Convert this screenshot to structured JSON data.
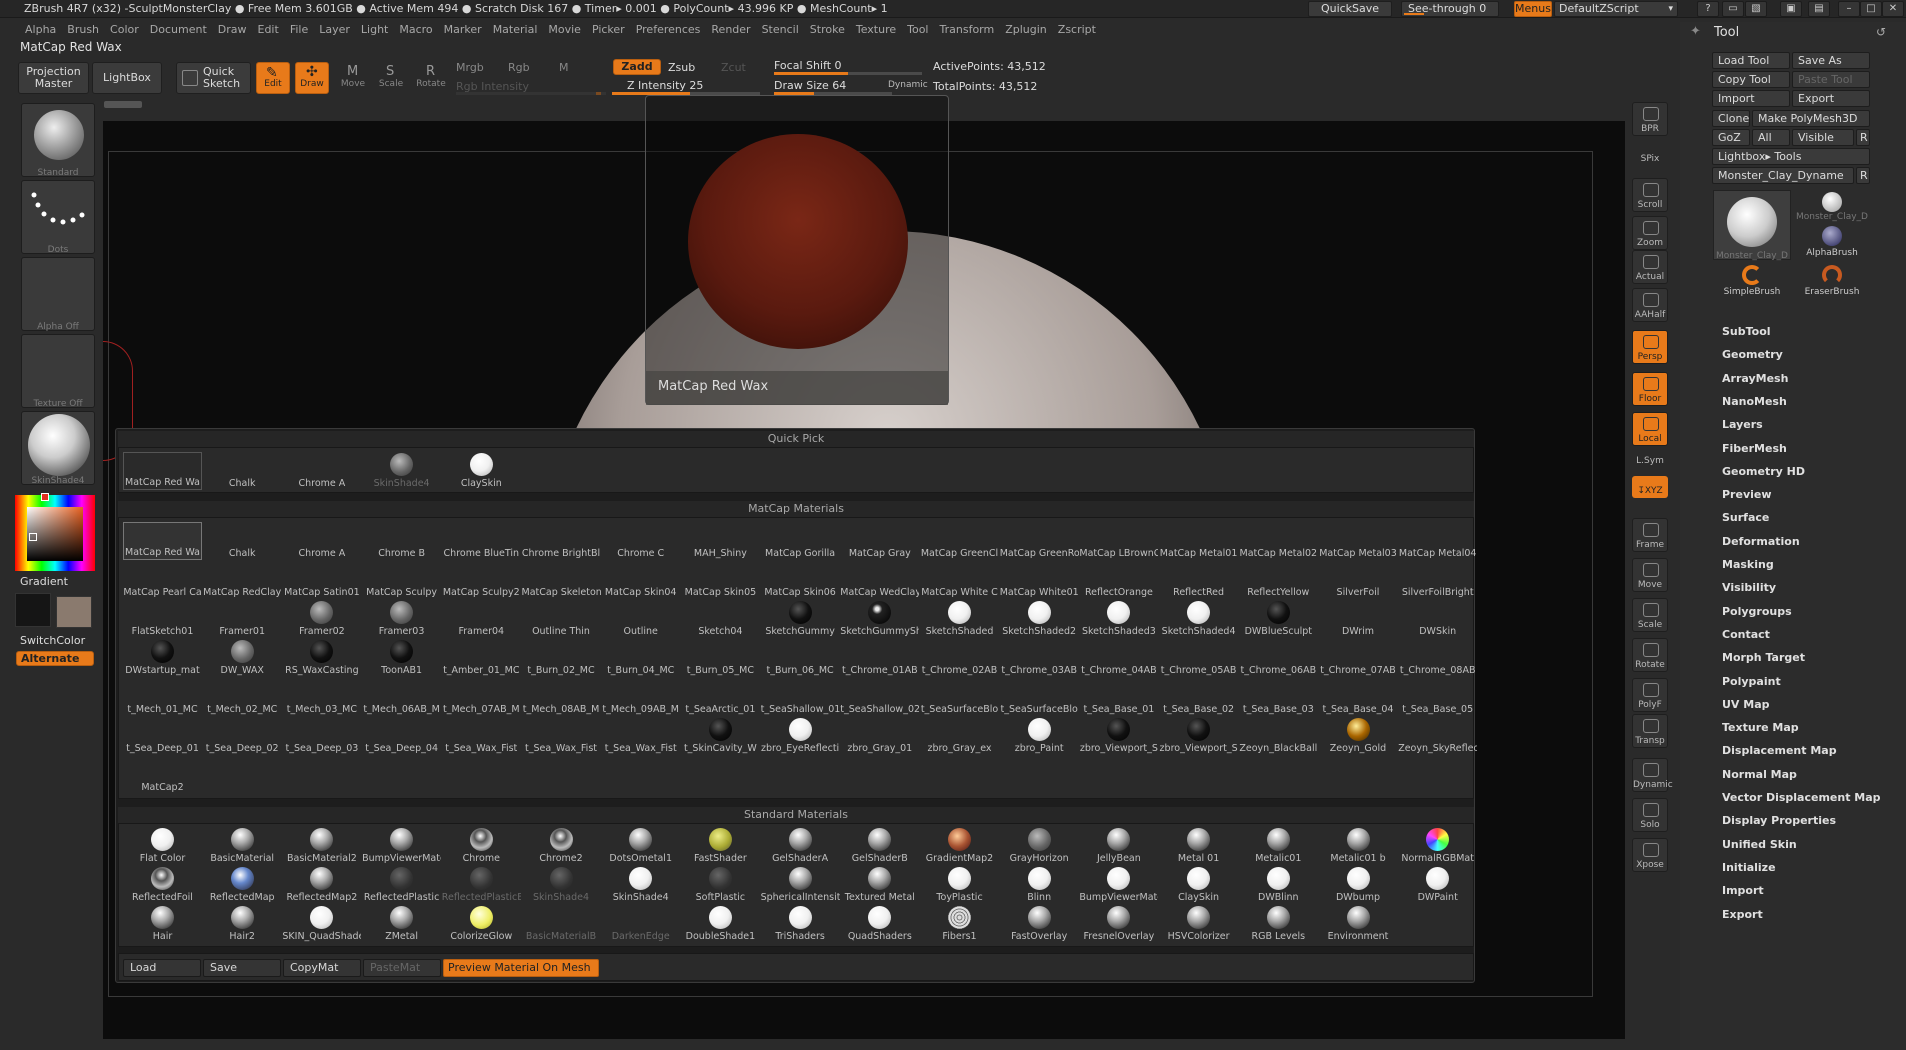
{
  "title_bar": {
    "text": "ZBrush 4R7 (x32)   -SculptMonsterClay   ● Free Mem 3.601GB ● Active Mem 494 ● Scratch Disk 167 ●  Timer▸ 0.001 ● PolyCount▸ 43.996 KP  ● MeshCount▸ 1",
    "quicksave": "QuickSave",
    "see_through": "See-through  0",
    "menus": "Menus",
    "script": "DefaultZScript"
  },
  "menu_bar": [
    "Alpha",
    "Brush",
    "Color",
    "Document",
    "Draw",
    "Edit",
    "File",
    "Layer",
    "Light",
    "Macro",
    "Marker",
    "Material",
    "Movie",
    "Picker",
    "Preferences",
    "Render",
    "Stencil",
    "Stroke",
    "Texture",
    "Tool",
    "Transform",
    "Zplugin",
    "Zscript"
  ],
  "material_name": "MatCap Red Wax",
  "top_shelf": {
    "projection_master": "Projection Master",
    "lightbox": "LightBox",
    "quick_sketch": "Quick Sketch",
    "edit": "Edit",
    "draw": "Draw",
    "move": "Move",
    "scale": "Scale",
    "rotate": "Rotate",
    "mrgb": "Mrgb",
    "rgb": "Rgb",
    "m": "M",
    "zadd": "Zadd",
    "zsub": "Zsub",
    "zcut": "Zcut",
    "rgb_intensity": "Rgb Intensity",
    "z_intensity": "Z Intensity 25",
    "focal_shift": "Focal Shift 0",
    "draw_size": "Draw Size 64",
    "dynamic": "Dynamic",
    "active_points": "ActivePoints: 43,512",
    "total_points": "TotalPoints: 43,512"
  },
  "left_panel": {
    "standard": "Standard",
    "dots": "Dots",
    "alpha_off": "Alpha Off",
    "texture_off": "Texture Off",
    "skinshade": "SkinShade4",
    "gradient": "Gradient",
    "switchcolor": "SwitchColor",
    "alternate": "Alternate"
  },
  "preview_popup_label": "MatCap Red Wax",
  "right_strip": [
    {
      "name": "bpr",
      "label": "BPR"
    },
    {
      "name": "spix",
      "label": "SPix"
    },
    {
      "name": "scroll",
      "label": "Scroll"
    },
    {
      "name": "zoom",
      "label": "Zoom"
    },
    {
      "name": "actual",
      "label": "Actual"
    },
    {
      "name": "aahalf",
      "label": "AAHalf"
    },
    {
      "name": "persp",
      "label": "Persp"
    },
    {
      "name": "floor",
      "label": "Floor"
    },
    {
      "name": "local",
      "label": "Local"
    },
    {
      "name": "lsym",
      "label": "L.Sym"
    },
    {
      "name": "xyz",
      "label": "↧XYZ"
    },
    {
      "name": "frame",
      "label": "Frame"
    },
    {
      "name": "move",
      "label": "Move"
    },
    {
      "name": "scale",
      "label": "Scale"
    },
    {
      "name": "rotate",
      "label": "Rotate"
    },
    {
      "name": "polyf",
      "label": "PolyF"
    },
    {
      "name": "transp",
      "label": "Transp"
    },
    {
      "name": "ghost",
      "label": "Dynamic"
    },
    {
      "name": "solo",
      "label": "Solo"
    },
    {
      "name": "xpose",
      "label": "Xpose"
    }
  ],
  "tool_panel": {
    "title": "Tool",
    "load_tool": "Load Tool",
    "save_as": "Save As",
    "copy_tool": "Copy Tool",
    "paste_tool": "Paste Tool",
    "import": "Import",
    "export": "Export",
    "clone": "Clone",
    "make_polymesh": "Make PolyMesh3D",
    "goz": "GoZ",
    "all": "All",
    "visible": "Visible",
    "r": "R",
    "lightbox_tools": "Lightbox▸ Tools",
    "current_tool": "Monster_Clay_Dyname",
    "thumbs": [
      "Monster_Clay_D",
      "Monster_Clay_D",
      "AlphaBrush",
      "SimpleBrush",
      "EraserBrush"
    ],
    "menu_items": [
      "SubTool",
      "Geometry",
      "ArrayMesh",
      "NanoMesh",
      "Layers",
      "FiberMesh",
      "Geometry HD",
      "Preview",
      "Surface",
      "Deformation",
      "Masking",
      "Visibility",
      "Polygroups",
      "Contact",
      "Morph Target",
      "Polypaint",
      "UV Map",
      "Texture Map",
      "Displacement Map",
      "Normal Map",
      "Vector Displacement Map",
      "Display Properties",
      "Unified Skin",
      "Initialize",
      "Import",
      "Export"
    ]
  },
  "material_palette": {
    "quick_pick_title": "Quick Pick",
    "quick_pick": [
      {
        "name": "MatCap Red Wa",
        "sphere": "none"
      },
      {
        "name": "Chalk",
        "sphere": "none"
      },
      {
        "name": "Chrome A",
        "sphere": "none"
      },
      {
        "name": "SkinShade4",
        "sphere": "grey",
        "dim": true
      },
      {
        "name": "ClaySkin",
        "sphere": "white"
      }
    ],
    "matcap_title": "MatCap Materials",
    "matcap": [
      [
        "MatCap Red Wa",
        "Chalk",
        "Chrome A",
        "Chrome B",
        "Chrome BlueTin",
        "Chrome BrightBl",
        "Chrome C",
        "MAH_Shiny",
        "MatCap Gorilla",
        "MatCap Gray",
        "MatCap GreenCl",
        "MatCap GreenRo",
        "MatCap LBrownC",
        "MatCap Metal01",
        "MatCap Metal02",
        "MatCap Metal03",
        "MatCap Metal04"
      ],
      [
        "MatCap Pearl Ca",
        "MatCap RedClay",
        "MatCap Satin01",
        "MatCap Sculpy",
        "MatCap Sculpy2",
        "MatCap Skeleton",
        "MatCap Skin04",
        "MatCap Skin05",
        "MatCap Skin06",
        "MatCap WedClay",
        "MatCap White C",
        "MatCap White01",
        "ReflectOrange",
        "ReflectRed",
        "ReflectYellow",
        "SilverFoil",
        "SilverFoilBright"
      ],
      [
        "FlatSketch01",
        "Framer01",
        "Framer02",
        "Framer03",
        "Framer04",
        "Outline Thin",
        "Outline",
        "Sketch04",
        "SketchGummy",
        "SketchGummyShi",
        "SketchShaded",
        "SketchShaded2",
        "SketchShaded3",
        "SketchShaded4",
        "DWBlueSculpt",
        "DWrim",
        "DWSkin"
      ],
      [
        "DWstartup_mat",
        "DW_WAX",
        "RS_WaxCasting",
        "ToonAB1",
        "t_Amber_01_MC",
        "t_Burn_02_MC",
        "t_Burn_04_MC",
        "t_Burn_05_MC",
        "t_Burn_06_MC",
        "t_Chrome_01AB",
        "t_Chrome_02AB",
        "t_Chrome_03AB",
        "t_Chrome_04AB",
        "t_Chrome_05AB",
        "t_Chrome_06AB",
        "t_Chrome_07AB",
        "t_Chrome_08AB"
      ],
      [
        "t_Mech_01_MC",
        "t_Mech_02_MC",
        "t_Mech_03_MC",
        "t_Mech_06AB_M",
        "t_Mech_07AB_M",
        "t_Mech_08AB_M",
        "t_Mech_09AB_M",
        "t_SeaArctic_01",
        "t_SeaShallow_01",
        "t_SeaShallow_02",
        "t_SeaSurfaceBlo",
        "t_SeaSurfaceBlo",
        "t_Sea_Base_01",
        "t_Sea_Base_02",
        "t_Sea_Base_03",
        "t_Sea_Base_04",
        "t_Sea_Base_05"
      ],
      [
        "t_Sea_Deep_01",
        "t_Sea_Deep_02",
        "t_Sea_Deep_03",
        "t_Sea_Deep_04",
        "t_Sea_Wax_Fist",
        "t_Sea_Wax_Fist",
        "t_Sea_Wax_Fist",
        "t_SkinCavity_W",
        "zbro_EyeReflecti",
        "zbro_Gray_01",
        "zbro_Gray_ex",
        "zbro_Paint",
        "zbro_Viewport_S",
        "zbro_Viewport_S",
        "Zeoyn_BlackBall",
        "Zeoyn_Gold",
        "Zeoyn_SkyReflec"
      ],
      [
        "MatCap2"
      ]
    ],
    "matcap_spheres": [
      [
        "",
        "",
        "",
        "",
        "",
        "",
        "",
        "",
        "",
        "",
        "",
        "",
        "",
        "",
        "",
        "",
        ""
      ],
      [
        "",
        "",
        "",
        "",
        "",
        "",
        "",
        "",
        "",
        "",
        "",
        "",
        "",
        "",
        "",
        "",
        ""
      ],
      [
        "",
        "",
        "grey",
        "grey",
        "",
        "",
        "",
        "",
        "black",
        "blackhl",
        "white",
        "white",
        "white",
        "white",
        "black",
        "",
        ""
      ],
      [
        "black",
        "grey",
        "black",
        "black",
        "",
        "",
        "",
        "",
        "",
        "",
        "",
        "",
        "",
        "",
        "",
        "",
        ""
      ],
      [
        "",
        "",
        "",
        "",
        "",
        "",
        "",
        "",
        "",
        "",
        "",
        "",
        "",
        "",
        "",
        "",
        ""
      ],
      [
        "",
        "",
        "",
        "",
        "",
        "",
        "",
        "black",
        "white",
        "",
        "",
        "white",
        "black",
        "black",
        "",
        "gold",
        ""
      ],
      [
        ""
      ]
    ],
    "standard_title": "Standard Materials",
    "standard": [
      [
        "Flat Color",
        "BasicMaterial",
        "BasicMaterial2",
        "BumpViewerMate",
        "Chrome",
        "Chrome2",
        "DotsOmetal1",
        "FastShader",
        "GelShaderA",
        "GelShaderB",
        "GradientMap2",
        "GrayHorizon",
        "JellyBean",
        "Metal 01",
        "Metalic01",
        "Metalic01 b",
        "NormalRGBMat"
      ],
      [
        "ReflectedFoil",
        "ReflectedMap",
        "ReflectedMap2",
        "ReflectedPlastic",
        "ReflectedPlasticB",
        "SkinShade4",
        "SkinShade4",
        "SoftPlastic",
        "SphericalIntensity",
        "Textured Metal",
        "ToyPlastic",
        "Blinn",
        "BumpViewerMate",
        "ClaySkin",
        "DWBlinn",
        "DWbump",
        "DWPaint"
      ],
      [
        "Hair",
        "Hair2",
        "SKIN_QuadShader",
        "ZMetal",
        "ColorizeGlow",
        "BasicMaterialB",
        "DarkenEdge",
        "DoubleShade1",
        "TriShaders",
        "QuadShaders",
        "Fibers1",
        "FastOverlay",
        "FresnelOverlay",
        "HSVColorizer",
        "RGB Levels",
        "Environment",
        ""
      ]
    ],
    "standard_spheres": [
      [
        "white",
        "silver",
        "silver",
        "silver",
        "chrome",
        "chrome",
        "silver",
        "yellow",
        "silver",
        "silver",
        "copper",
        "grey",
        "silver",
        "silver",
        "silver",
        "silver",
        "rainbow"
      ],
      [
        "chrome",
        "blue",
        "silver",
        "dark",
        "dark",
        "dark",
        "white",
        "dark",
        "silver",
        "silver",
        "white",
        "white",
        "white",
        "white",
        "white",
        "white",
        "white"
      ],
      [
        "silver",
        "silver",
        "white",
        "silver",
        "yellowglow",
        "",
        "",
        "white",
        "white",
        "white",
        "fibers",
        "silver",
        "silver",
        "silver",
        "silver",
        "silver",
        ""
      ]
    ],
    "standard_dim": [
      [],
      [
        4,
        5
      ],
      [
        5,
        6
      ]
    ],
    "buttons": {
      "load": "Load",
      "save": "Save",
      "copymat": "CopyMat",
      "pastemat": "PasteMat",
      "preview": "Preview Material On Mesh"
    }
  },
  "colors": {
    "accent": "#e87a1a",
    "panel_bg": "#2a2a2a",
    "canvas_bg": "#0c0c0c",
    "red_wax": "#6e1e12"
  }
}
